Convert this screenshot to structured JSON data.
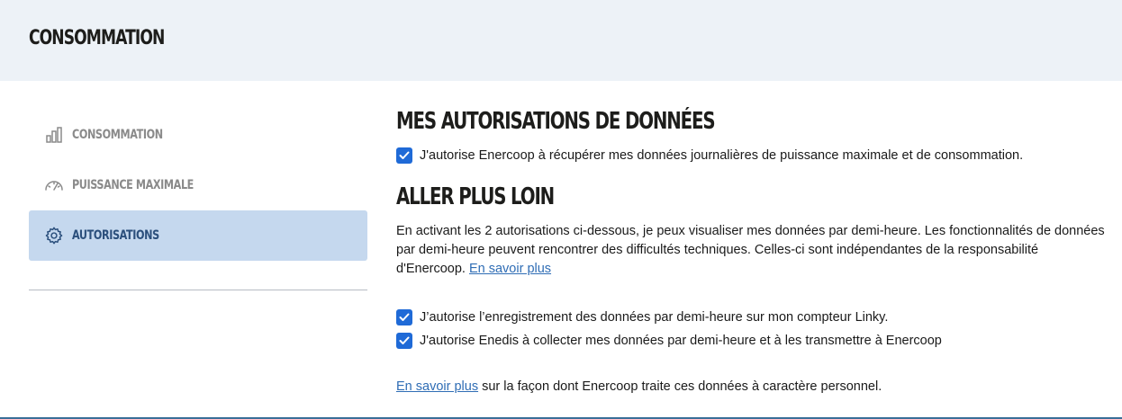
{
  "header": {
    "title": "CONSOMMATION"
  },
  "sidebar": {
    "items": [
      {
        "label": "CONSOMMATION",
        "icon": "bar-chart-icon",
        "active": false
      },
      {
        "label": "PUISSANCE MAXIMALE",
        "icon": "gauge-icon",
        "active": false
      },
      {
        "label": "AUTORISATIONS",
        "icon": "gear-icon",
        "active": true
      }
    ]
  },
  "main": {
    "autorisations": {
      "title": "MES AUTORISATIONS DE DONNÉES",
      "checkbox_label": "J'autorise Enercoop à récupérer mes données journalières de puissance maximale et de consommation.",
      "checked": true
    },
    "aller_plus_loin": {
      "title": "ALLER PLUS LOIN",
      "paragraph": "En activant les 2 autorisations ci-dessous, je peux visualiser mes données par demi-heure. Les fonctionnalités de données par demi-heure peuvent rencontrer des difficultés techniques. Celles-ci sont indépendantes de la responsabilité d'Enercoop.",
      "paragraph_link": "En savoir plus",
      "checkboxes": [
        {
          "label": "J’autorise l’enregistrement des données par demi-heure sur mon compteur Linky.",
          "checked": true
        },
        {
          "label": "J'autorise Enedis à collecter mes données par demi-heure et à les transmettre à Enercoop",
          "checked": true
        }
      ],
      "footer_link": "En savoir plus",
      "footer_text": " sur la façon dont Enercoop traite ces données à caractère personnel."
    }
  },
  "colors": {
    "header_bg": "#edf2f7",
    "active_nav_bg": "#c5d8ee",
    "active_nav_text": "#2b4f7c",
    "checkbox": "#1f6ad7",
    "link": "#2f6db5"
  }
}
